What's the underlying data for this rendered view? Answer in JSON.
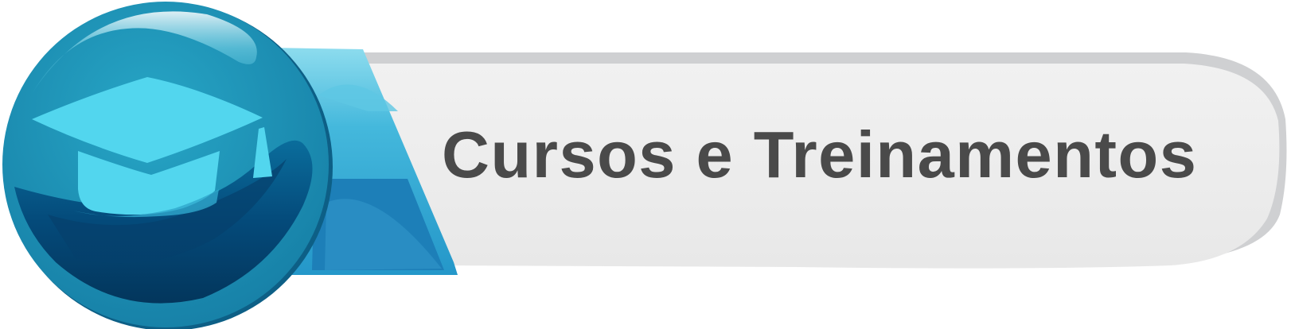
{
  "banner": {
    "title": "Cursos e Treinamentos",
    "icon": "graduation-cap-icon",
    "colors": {
      "title_text": "#4a4a4a",
      "banner_fill": "#ececec",
      "badge_blue": "#1d93b5",
      "cap_cyan": "#52d6ee",
      "deep_navy": "#033a64"
    }
  }
}
